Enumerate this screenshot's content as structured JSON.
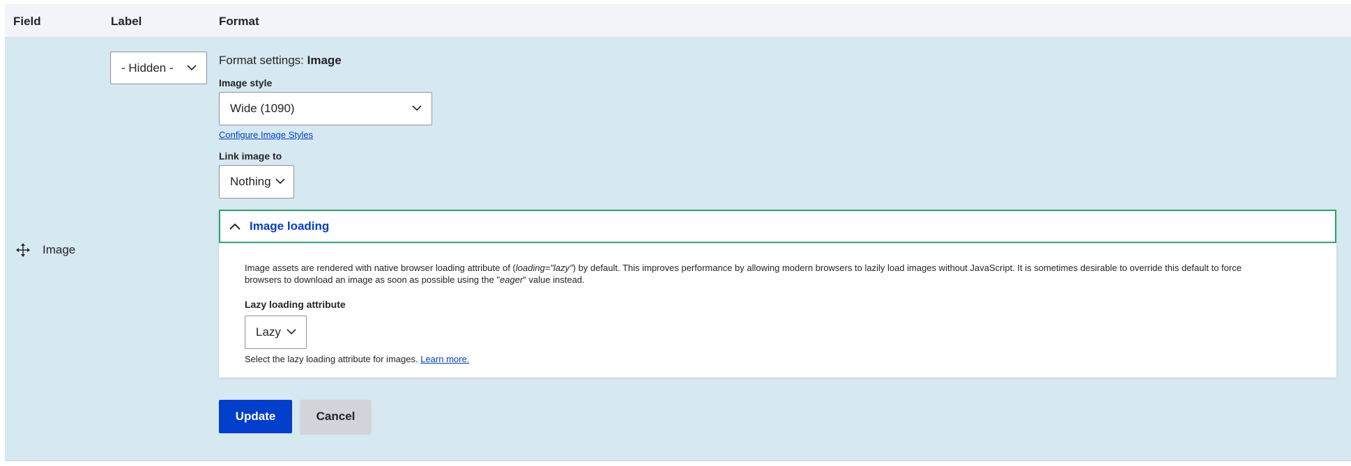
{
  "table": {
    "headers": {
      "field": "Field",
      "label": "Label",
      "format": "Format"
    },
    "row": {
      "field_name": "Image",
      "label_select": {
        "value": "- Hidden -"
      }
    }
  },
  "format_settings": {
    "title_prefix": "Format settings:",
    "title_name": "Image",
    "image_style": {
      "label": "Image style",
      "value": "Wide (1090)"
    },
    "configure_link": "Configure Image Styles",
    "link_image_to": {
      "label": "Link image to",
      "value": "Nothing"
    },
    "image_loading": {
      "summary": "Image loading",
      "expanded": true,
      "description_part1": "Image assets are rendered with native browser loading attribute of (",
      "description_code1": "loading=\"lazy\"",
      "description_part2": ") by default. This improves performance by allowing modern browsers to lazily load images without JavaScript. It is sometimes desirable to override this default to force browsers to download an image as soon as possible using the \"",
      "description_code2": "eager",
      "description_part3": "\" value instead.",
      "lazy_label": "Lazy loading attribute",
      "lazy_value": "Lazy",
      "help_text": "Select the lazy loading attribute for images.",
      "help_link": "Learn more."
    }
  },
  "actions": {
    "update": "Update",
    "cancel": "Cancel"
  },
  "colors": {
    "row_background": "#d6e8f0",
    "primary_button": "#003ecc",
    "link": "#003ecc",
    "focus_border": "#26a769"
  },
  "icons": {
    "drag_handle": "move-icon",
    "select_arrow": "chevron-down-icon",
    "details_toggle": "chevron-up-icon"
  }
}
